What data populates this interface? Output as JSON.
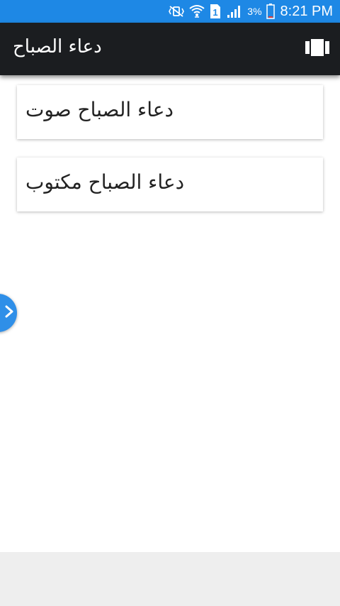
{
  "status_bar": {
    "battery_percent": "3%",
    "time": "8:21 PM",
    "sim_slot": "1",
    "icons": [
      "mute-vibrate-icon",
      "wifi-icon",
      "sim-icon",
      "signal-icon",
      "battery-icon"
    ],
    "background_color": "#1e88e5"
  },
  "app_bar": {
    "title": "دعاء الصباح",
    "action_icon": "view-carousel-icon",
    "background_color": "#1b1d20"
  },
  "menu": {
    "items": [
      {
        "label": "دعاء الصباح صوت"
      },
      {
        "label": "دعاء الصباح مكتوب"
      }
    ]
  },
  "drawer_handle": {
    "icon": "chevron-right-icon",
    "color": "#2f8fe8"
  },
  "bottom_bar": {
    "background_color": "#eeeeee"
  }
}
